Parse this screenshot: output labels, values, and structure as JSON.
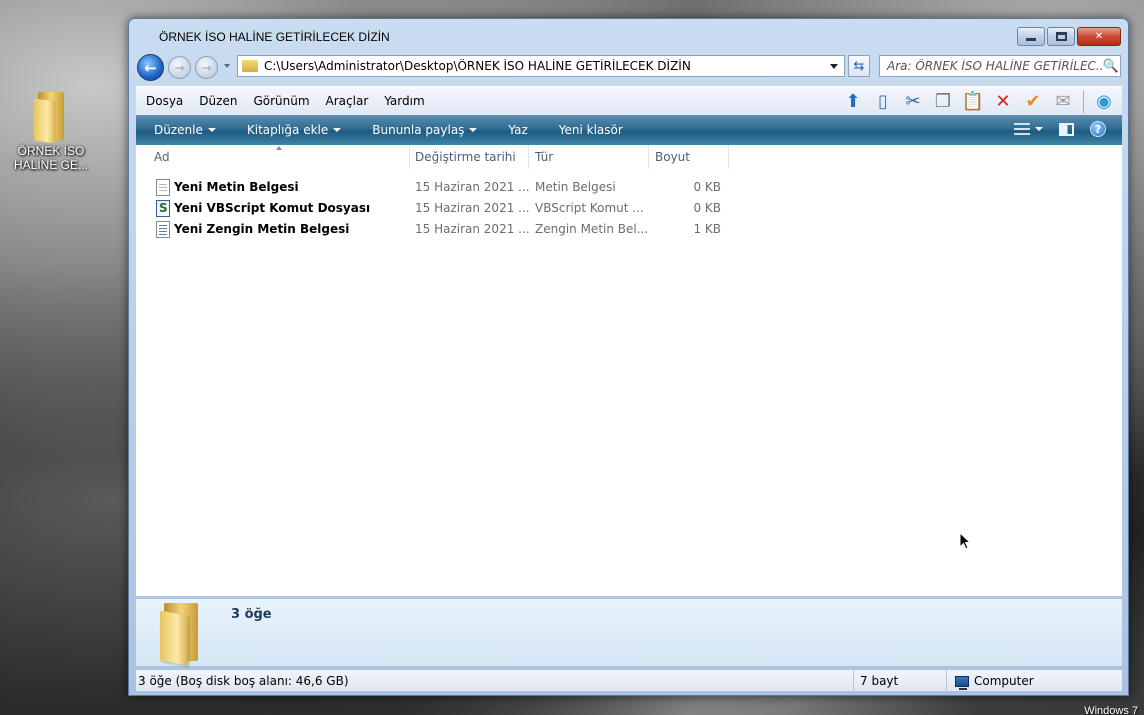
{
  "desktop": {
    "icon_label": "ÖRNEK İSO HALİNE GE...",
    "watermark": "Windows 7"
  },
  "window": {
    "title": "ÖRNEK İSO HALİNE GETİRİLECEK DİZİN",
    "caption": {
      "minimize": "minimize",
      "maximize": "maximize",
      "close": "✕"
    }
  },
  "nav": {
    "back_icon": "←",
    "forward_icon": "→",
    "address": "C:\\Users\\Administrator\\Desktop\\ÖRNEK İSO HALİNE GETİRİLECEK DİZİN",
    "refresh_icon": "⇆",
    "search_placeholder": "Ara: ÖRNEK İSO HALİNE GETİRİLEC...",
    "search_icon": "🔍"
  },
  "menubar": {
    "items": [
      "Dosya",
      "Düzen",
      "Görünüm",
      "Araçlar",
      "Yardım"
    ],
    "tool_icons": {
      "up": "⬆",
      "folders": "▯",
      "cut": "✂",
      "copy": "❐",
      "paste": "📋",
      "delete": "✕",
      "properties": "✔",
      "mail": "✉",
      "globe": "◉"
    }
  },
  "cmdbar": {
    "items": [
      "Düzenle",
      "Kitaplığa ekle",
      "Bununla paylaş",
      "Yaz",
      "Yeni klasör"
    ],
    "help_icon": "?"
  },
  "columns": {
    "name": "Ad",
    "date": "Değiştirme tarihi",
    "type": "Tür",
    "size": "Boyut"
  },
  "files": [
    {
      "name": "Yeni Metin Belgesi",
      "date": "15 Haziran 2021 ...",
      "type": "Metin Belgesi",
      "size": "0 KB",
      "icon": "text-file-icon"
    },
    {
      "name": "Yeni VBScript Komut Dosyası",
      "date": "15 Haziran 2021 ...",
      "type": "VBScript Komut ...",
      "size": "0 KB",
      "icon": "vbscript-file-icon"
    },
    {
      "name": "Yeni Zengin Metin Belgesi",
      "date": "15 Haziran 2021 ...",
      "type": "Zengin Metin Bel...",
      "size": "1 KB",
      "icon": "rtf-file-icon"
    }
  ],
  "details": {
    "count": "3 öğe"
  },
  "statusbar": {
    "left": "3 öğe (Boş disk boş alanı: 46,6 GB)",
    "size": "7 bayt",
    "location": "Computer"
  },
  "colors": {
    "cmdbar": "#2f6d92",
    "window_frame": "#b7cde6"
  }
}
